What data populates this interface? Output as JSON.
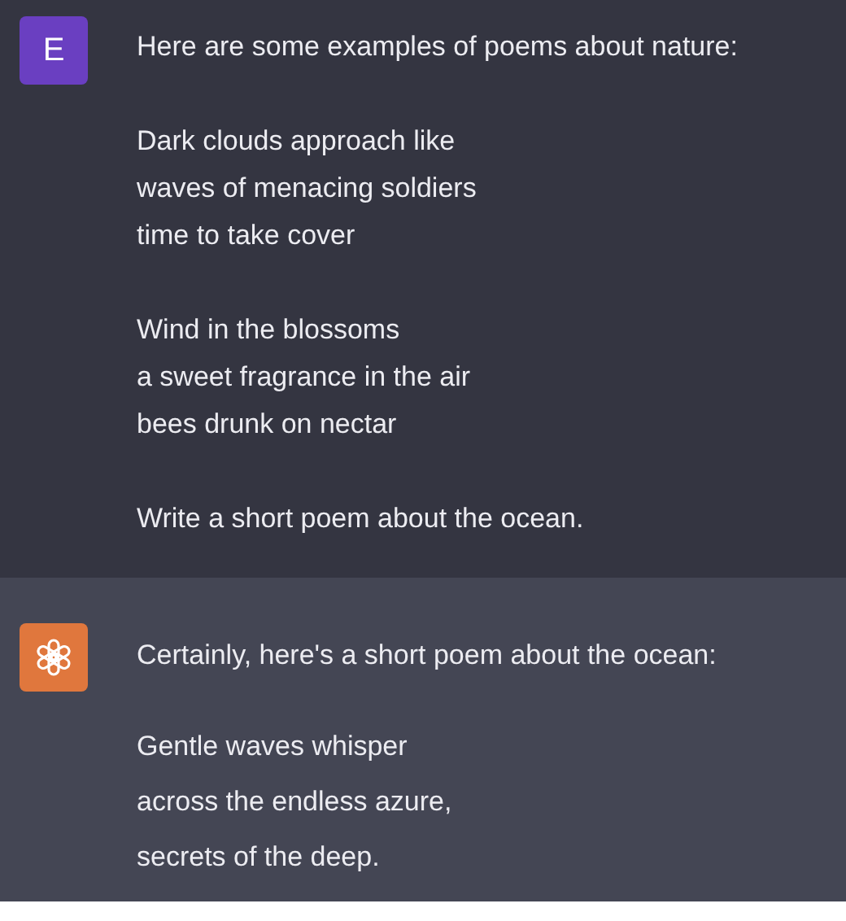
{
  "messages": [
    {
      "kind": "user",
      "avatar": "E",
      "paragraphs": [
        [
          "Here are some examples of poems about nature:"
        ],
        [
          "Dark clouds approach like",
          "waves of menacing soldiers",
          "time to take cover"
        ],
        [
          "Wind in the blossoms",
          "a sweet fragrance in the air",
          "bees drunk on nectar"
        ],
        [
          "Write a short poem about the ocean."
        ]
      ]
    },
    {
      "kind": "assistant",
      "paragraphs": [
        [
          "Certainly, here's a short poem about the ocean:"
        ],
        [
          "Gentle waves whisper",
          "across the endless azure,",
          "secrets of the deep."
        ]
      ]
    }
  ]
}
